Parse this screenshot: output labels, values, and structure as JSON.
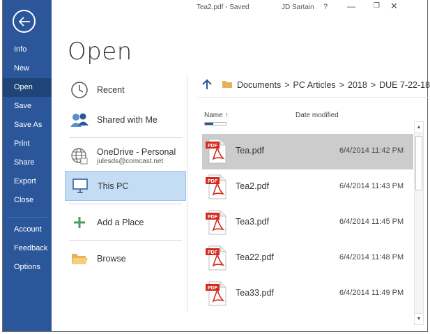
{
  "titlebar": {
    "file_status": "Tea2.pdf  -  Saved",
    "user": "JD Sartain",
    "help": "?",
    "minimize": "—",
    "maximize": "❐",
    "close": "✕"
  },
  "nav": {
    "items": [
      {
        "label": "Info"
      },
      {
        "label": "New"
      },
      {
        "label": "Open"
      },
      {
        "label": "Save"
      },
      {
        "label": "Save As"
      },
      {
        "label": "Print"
      },
      {
        "label": "Share"
      },
      {
        "label": "Export"
      },
      {
        "label": "Close"
      },
      {
        "label": "Account"
      },
      {
        "label": "Feedback"
      },
      {
        "label": "Options"
      }
    ],
    "active_index": 2
  },
  "page_title": "Open",
  "places": {
    "recent": "Recent",
    "shared": "Shared with Me",
    "onedrive": "OneDrive - Personal",
    "onedrive_account": "julesds@comcast.net",
    "thispc": "This PC",
    "addplace": "Add a Place",
    "browse": "Browse"
  },
  "breadcrumb": [
    "Documents",
    "PC Articles",
    "2018",
    "DUE 7-22-18"
  ],
  "breadcrumb_separator": ">",
  "columns": {
    "name": "Name ↑",
    "date": "Date modified"
  },
  "files": [
    {
      "name": "Tea.pdf",
      "date": "6/4/2014 11:42 PM",
      "selected": true
    },
    {
      "name": "Tea2.pdf",
      "date": "6/4/2014 11:43 PM",
      "selected": false
    },
    {
      "name": "Tea3.pdf",
      "date": "6/4/2014 11:45 PM",
      "selected": false
    },
    {
      "name": "Tea22.pdf",
      "date": "6/4/2014 11:48 PM",
      "selected": false
    },
    {
      "name": "Tea33.pdf",
      "date": "6/4/2014 11:49 PM",
      "selected": false
    }
  ],
  "file_icon_badge": "PDF",
  "icons": {
    "back": "back-arrow-icon",
    "recent": "clock-icon",
    "shared": "people-icon",
    "onedrive": "globe-icon",
    "thispc": "computer-icon",
    "addplace": "plus-icon",
    "browse": "folder-icon",
    "file": "pdf-icon",
    "up": "up-arrow-icon"
  },
  "colors": {
    "nav_bg": "#2b579a",
    "nav_active": "#1e4478",
    "selected_place": "#c5dcf5",
    "selected_file": "#cccccc",
    "pdf_red": "#d52b1e"
  }
}
